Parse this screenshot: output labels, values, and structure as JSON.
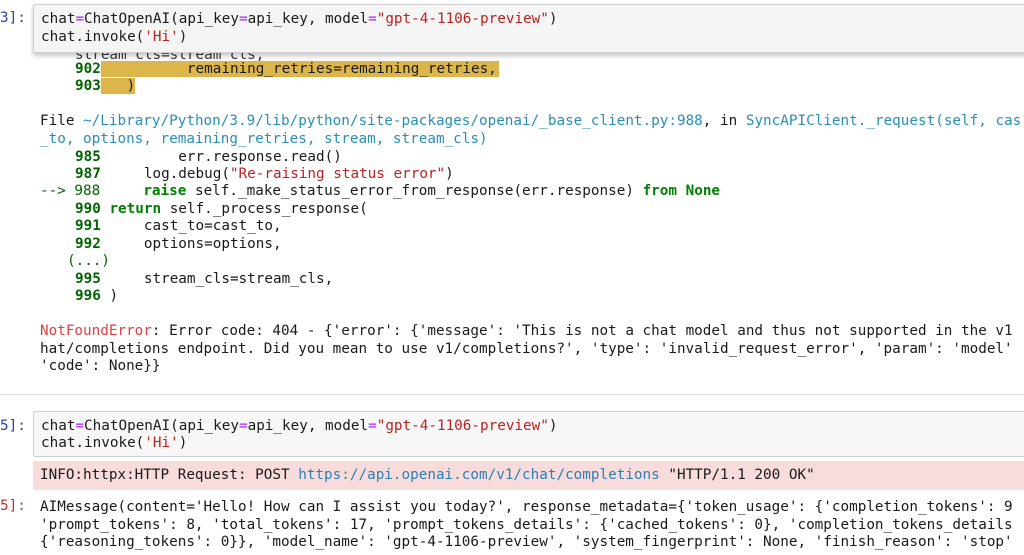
{
  "cell_top": {
    "prompt": "3]:",
    "line1": {
      "a": "chat",
      "eq": "=",
      "b": "ChatOpenAI(api_key",
      "eq2": "=",
      "c": "api_key, model",
      "eq3": "=",
      "s": "\"gpt-4-1106-preview\"",
      "d": ")"
    },
    "line2": {
      "a": "chat.invoke(",
      "s": "'Hi'",
      "b": ")"
    }
  },
  "traceback": {
    "partial_top": "stream_cls=stream_cls,",
    "l902_num": "902",
    "l902_code": "remaining_retries=remaining_retries,",
    "l903_num": "903",
    "l903_code": ")",
    "file_label": "File ",
    "file_path": "~/Library/Python/3.9/lib/python/site-packages/openai/_base_client.py:988",
    "file_in": ", in ",
    "file_func": "SyncAPIClient._request(self, cas",
    "file_func2": "_to, options, remaining_retries, stream, stream_cls)",
    "l985_num": "985",
    "l985_code": "err.response.read()",
    "l987_num": "987",
    "l987_code_a": "log.debug(",
    "l987_str": "\"Re-raising status error\"",
    "l987_code_b": ")",
    "l988_arrow": "--> 988",
    "l988_kw": "raise",
    "l988_code": " self._make_status_error_from_response(err.response) ",
    "l988_from": "from",
    "l988_none": "None",
    "l990_num": "990",
    "l990_kw": "return",
    "l990_code": " self._process_response(",
    "l991_num": "991",
    "l991_code": "cast_to=cast_to,",
    "l992_num": "992",
    "l992_code": "options=options,",
    "ellipsis": "(...)",
    "l995_num": "995",
    "l995_code": "stream_cls=stream_cls,",
    "l996_num": "996",
    "l996_code": ")",
    "error_name": "NotFoundError",
    "error_line1": ": Error code: 404 - {'error': {'message': 'This is not a chat model and thus not supported in the v1",
    "error_line2": "hat/completions endpoint. Did you mean to use v1/completions?', 'type': 'invalid_request_error', 'param': 'model'",
    "error_line3": "'code': None}}"
  },
  "cell_bottom": {
    "prompt": "5]:",
    "line1": {
      "a": "chat",
      "eq": "=",
      "b": "ChatOpenAI(api_key",
      "eq2": "=",
      "c": "api_key, model",
      "eq3": "=",
      "s": "\"gpt-4-1106-preview\"",
      "d": ")"
    },
    "line2": {
      "a": "chat.invoke(",
      "s": "'Hi'",
      "b": ")"
    }
  },
  "info": {
    "prefix": "INFO:httpx:HTTP Request: POST ",
    "url": "https://api.openai.com/v1/chat/completions",
    "suffix": " \"HTTP/1.1 200 OK\""
  },
  "output": {
    "prompt": "5]:",
    "line1": "AIMessage(content='Hello! How can I assist you today?', response_metadata={'token_usage': {'completion_tokens': 9",
    "line2": "'prompt_tokens': 8, 'total_tokens': 17, 'prompt_tokens_details': {'cached_tokens': 0}, 'completion_tokens_details",
    "line3": "{'reasoning_tokens': 0}}, 'model_name': 'gpt-4-1106-preview', 'system_fingerprint': None, 'finish_reason': 'stop'"
  }
}
